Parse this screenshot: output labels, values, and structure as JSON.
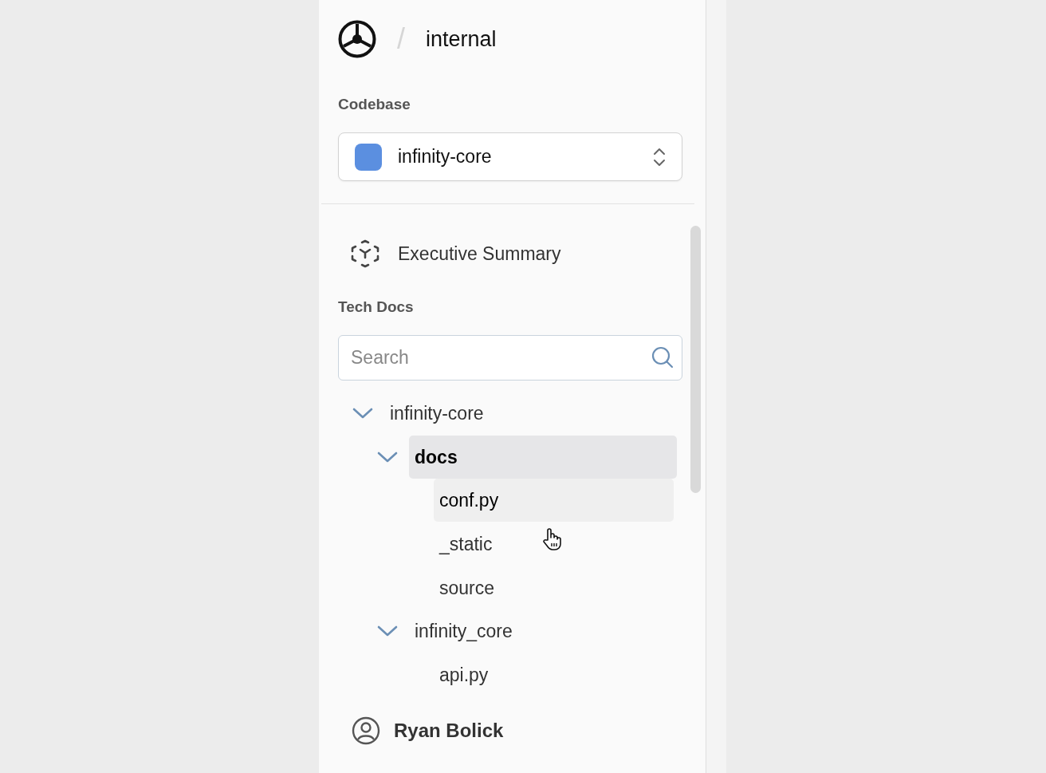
{
  "header": {
    "separator": "/",
    "workspace": "internal"
  },
  "codebase": {
    "label": "Codebase",
    "selected": "infinity-core",
    "color": "#5b8fe0"
  },
  "nav": [
    {
      "label": "Executive Summary"
    }
  ],
  "tech_docs": {
    "label": "Tech Docs",
    "search": {
      "placeholder": "Search"
    },
    "tree": [
      {
        "kind": "folder",
        "label": "infinity-core",
        "expanded": true,
        "selected": false,
        "hovered": false,
        "children": [
          {
            "kind": "folder",
            "label": "docs",
            "expanded": true,
            "selected": true,
            "hovered": false,
            "children": [
              {
                "kind": "leaf",
                "label": "conf.py",
                "selected": false,
                "hovered": true
              },
              {
                "kind": "leaf",
                "label": "_static",
                "selected": false,
                "hovered": false
              },
              {
                "kind": "leaf",
                "label": "source",
                "selected": false,
                "hovered": false
              }
            ]
          },
          {
            "kind": "folder",
            "label": "infinity_core",
            "expanded": true,
            "selected": false,
            "hovered": false,
            "children": [
              {
                "kind": "leaf",
                "label": "api.py",
                "selected": false,
                "hovered": false
              }
            ]
          }
        ]
      }
    ]
  },
  "user": {
    "name": "Ryan Bolick"
  }
}
